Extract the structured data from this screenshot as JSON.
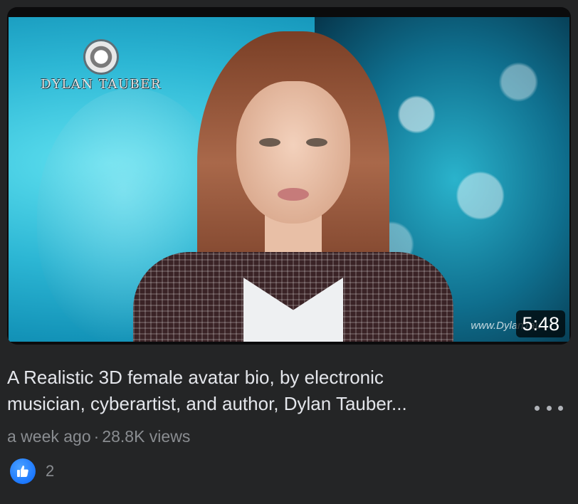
{
  "video": {
    "logo_text": "DYLAN TAUBER",
    "watermark": "www.DylanTau",
    "duration": "5:48"
  },
  "post": {
    "title_line1": "A Realistic 3D female avatar bio, by electronic",
    "title_line2": "musician, cyberartist, and author, Dylan Tauber...",
    "posted": "a week ago",
    "separator": "·",
    "views": "28.8K views",
    "like_count": "2"
  },
  "icons": {
    "more": "more-horizontal-icon",
    "like": "thumbs-up-icon"
  },
  "colors": {
    "background": "#242526",
    "like_blue": "#0866ff"
  }
}
